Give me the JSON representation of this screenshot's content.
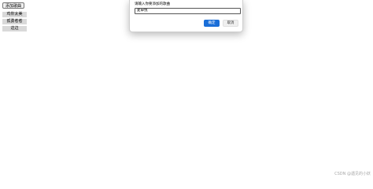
{
  "toolbar": {
    "add_button_label": "添加歌曲"
  },
  "list": {
    "items": [
      {
        "label": "鸡你太美"
      },
      {
        "label": "孤勇者者"
      },
      {
        "label": "这边"
      }
    ]
  },
  "dialog": {
    "message": "请输入你要添加的歌曲",
    "input_value": "麦卓悦",
    "ok_label": "确定",
    "cancel_label": "取消"
  },
  "footer": {
    "watermark": "CSDN @遇见的小妖"
  },
  "colors": {
    "primary_button": "#1a6ed8",
    "list_item_bg": "#d9d9d9"
  }
}
